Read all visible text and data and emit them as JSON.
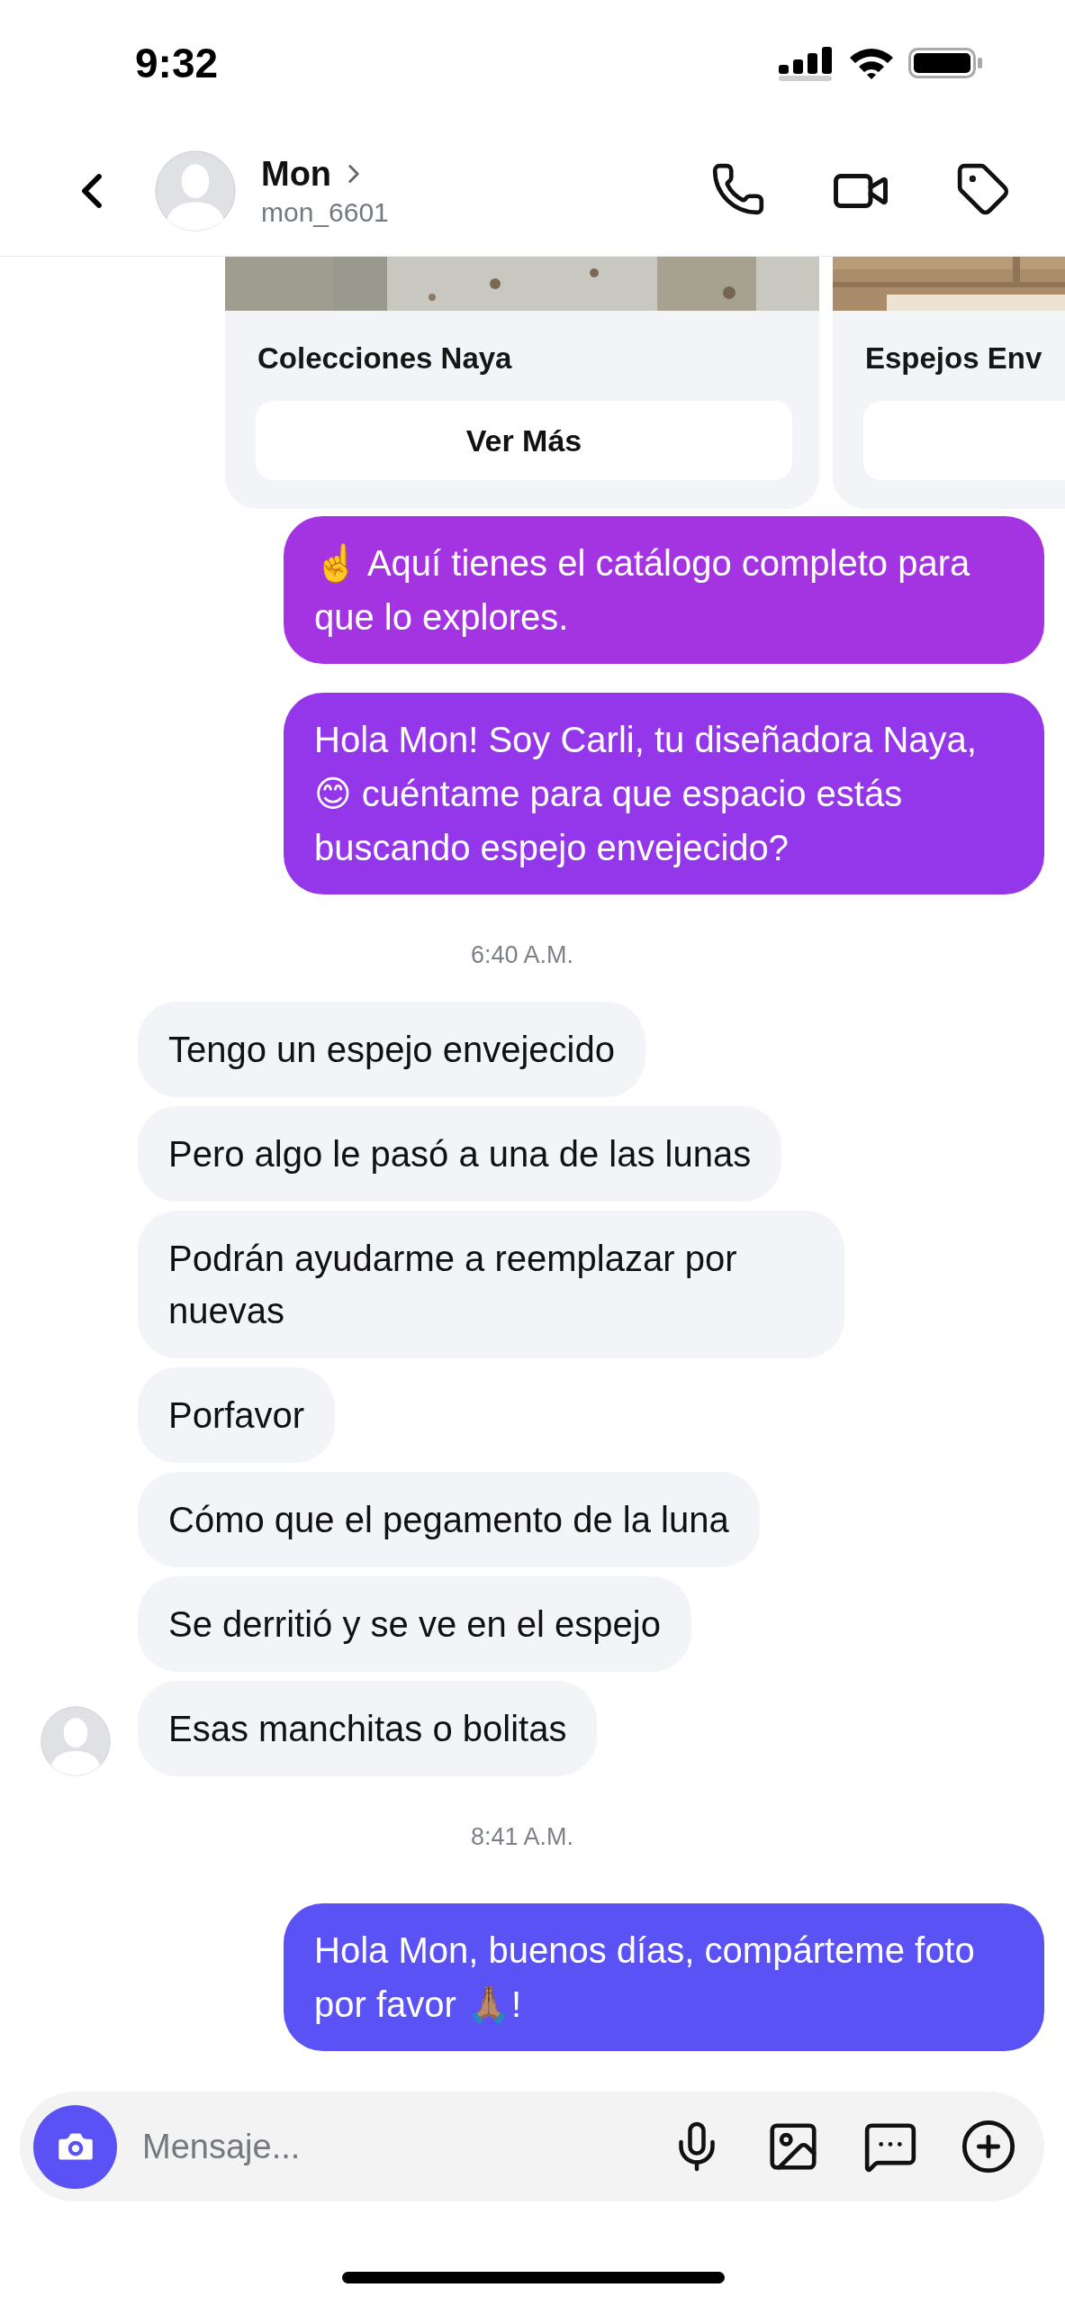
{
  "status_bar": {
    "time": "9:32"
  },
  "header": {
    "name": "Mon",
    "username": "mon_6601"
  },
  "cards": [
    {
      "title": "Colecciones Naya",
      "button": "Ver Más"
    },
    {
      "title": "Espejos Env"
    }
  ],
  "messages": [
    {
      "kind": "sent",
      "text": "☝️  Aquí tienes el catálogo completo para que lo explores.",
      "color": "#a433e2"
    },
    {
      "kind": "sent",
      "text": "Hola Mon! Soy Carli, tu diseñadora Naya, 😊  cuéntame para que espacio estás buscando espejo envejecido?",
      "color": "#9437ea"
    },
    {
      "kind": "timestamp",
      "text": "6:40 A.M."
    },
    {
      "kind": "received",
      "text": "Tengo un espejo envejecido",
      "show_avatar": false
    },
    {
      "kind": "received",
      "text": "Pero algo le pasó a una de las lunas",
      "show_avatar": false
    },
    {
      "kind": "received",
      "text": "Podrán ayudarme a reemplazar por nuevas",
      "show_avatar": false
    },
    {
      "kind": "received",
      "text": "Porfavor",
      "show_avatar": false
    },
    {
      "kind": "received",
      "text": "Cómo que el pegamento de la luna",
      "show_avatar": false
    },
    {
      "kind": "received",
      "text": "Se derritió y se ve en el espejo",
      "show_avatar": false
    },
    {
      "kind": "received",
      "text": "Esas manchitas o bolitas",
      "show_avatar": true
    },
    {
      "kind": "timestamp",
      "text": "8:41 A.M."
    },
    {
      "kind": "sent",
      "text": "Hola Mon, buenos días, compárteme foto por favor 🙏🏽!",
      "color": "#5b52f6"
    }
  ],
  "composer": {
    "placeholder": "Mensaje..."
  }
}
